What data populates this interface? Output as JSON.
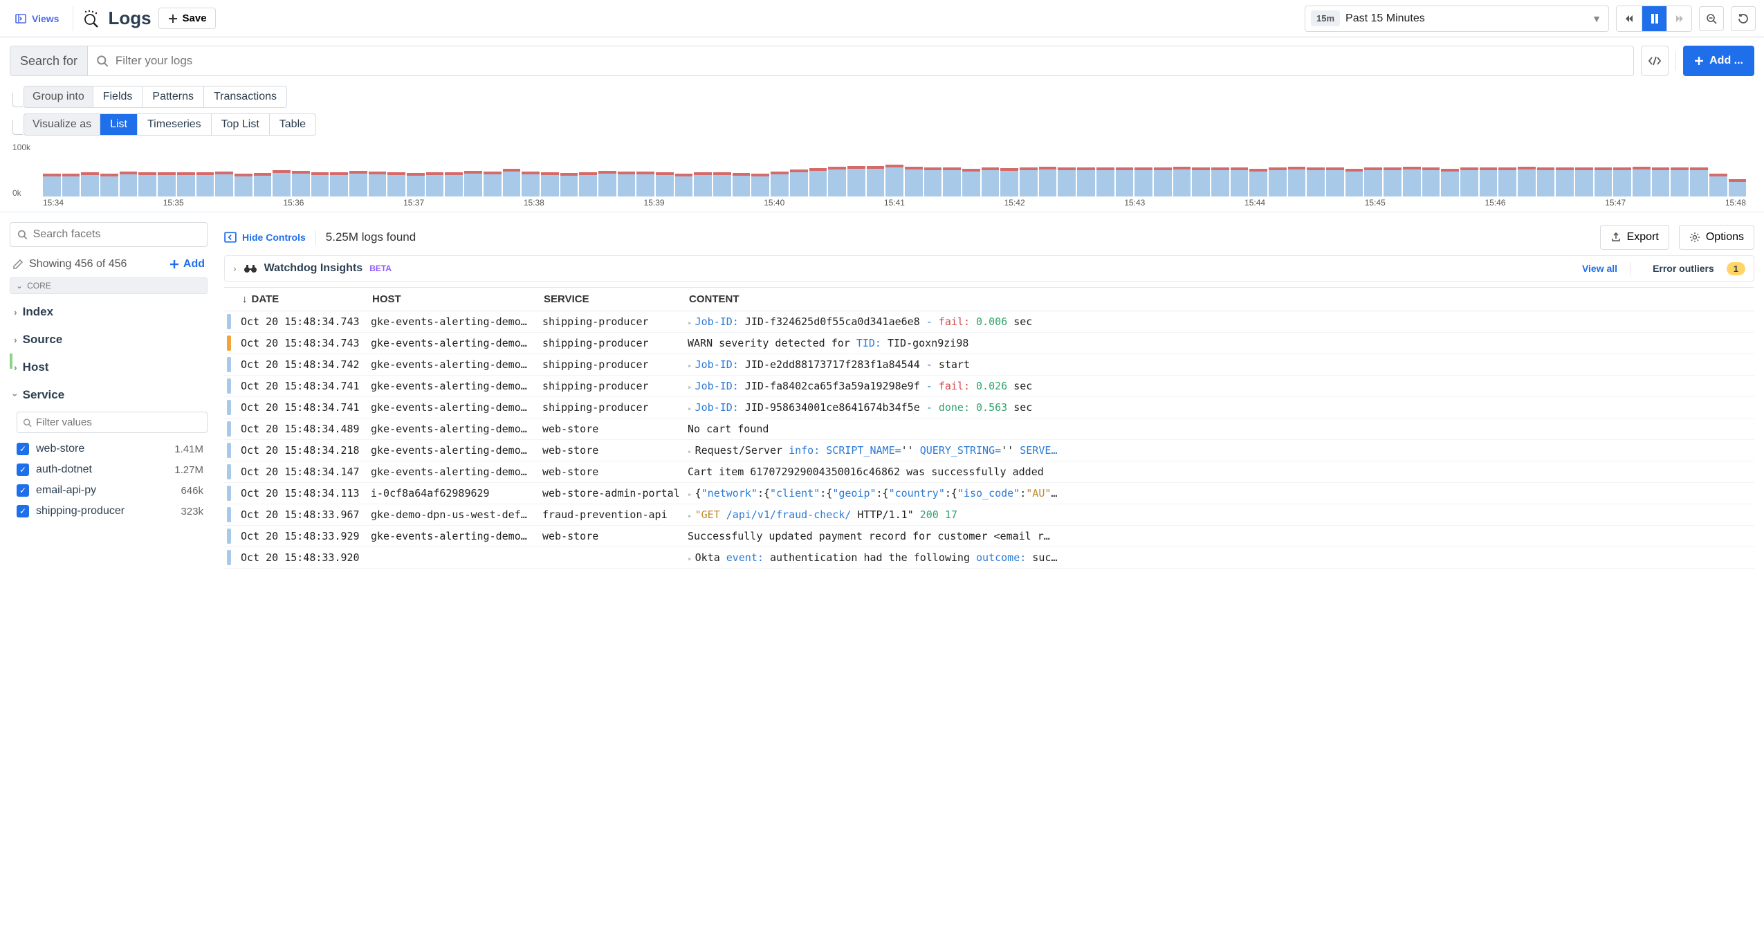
{
  "topbar": {
    "views": "Views",
    "title": "Logs",
    "save": "Save",
    "time_chip": "15m",
    "time_text": "Past 15 Minutes"
  },
  "search": {
    "label": "Search for",
    "placeholder": "Filter your logs",
    "add": "Add ..."
  },
  "group": {
    "label": "Group into",
    "fields": "Fields",
    "patterns": "Patterns",
    "transactions": "Transactions"
  },
  "visualize": {
    "label": "Visualize as",
    "list": "List",
    "timeseries": "Timeseries",
    "toplist": "Top List",
    "table": "Table"
  },
  "chart_data": {
    "type": "bar",
    "ylabel_top": "100k",
    "ylabel_bottom": "0k",
    "ylim": [
      0,
      100000
    ],
    "x_ticks": [
      "15:34",
      "15:35",
      "15:36",
      "15:37",
      "15:38",
      "15:39",
      "15:40",
      "15:41",
      "15:42",
      "15:43",
      "15:44",
      "15:45",
      "15:46",
      "15:47",
      "15:48"
    ],
    "series": [
      {
        "name": "logs",
        "values_k": [
          42,
          41,
          44,
          42,
          46,
          45,
          44,
          45,
          45,
          46,
          42,
          43,
          48,
          47,
          44,
          45,
          47,
          46,
          44,
          43,
          44,
          45,
          47,
          46,
          52,
          46,
          44,
          43,
          45,
          47,
          46,
          46,
          45,
          42,
          44,
          44,
          43,
          42,
          46,
          50,
          53,
          56,
          57,
          57,
          60,
          56,
          54,
          54,
          52,
          54,
          53,
          54,
          56,
          54,
          55,
          55,
          54,
          55,
          54,
          56,
          54,
          55,
          54,
          52,
          55,
          56,
          54,
          55,
          52,
          54,
          55,
          56,
          54,
          52,
          54,
          55,
          54,
          56,
          54,
          55,
          54,
          55,
          54,
          56,
          54,
          55,
          54,
          42,
          30
        ]
      }
    ]
  },
  "sidebar": {
    "facets_placeholder": "Search facets",
    "showing": "Showing 456 of 456",
    "add_label": "Add",
    "core": "CORE",
    "groups": {
      "index": "Index",
      "source": "Source",
      "host": "Host",
      "service": "Service"
    },
    "filter_values_placeholder": "Filter values",
    "service_items": [
      {
        "label": "web-store",
        "count": "1.41M"
      },
      {
        "label": "auth-dotnet",
        "count": "1.27M"
      },
      {
        "label": "email-api-py",
        "count": "646k"
      },
      {
        "label": "shipping-producer",
        "count": "323k"
      }
    ]
  },
  "content": {
    "hide_controls": "Hide Controls",
    "logs_found": "5.25M logs found",
    "export": "Export",
    "options": "Options",
    "watchdog": "Watchdog Insights",
    "beta": "BETA",
    "view_all": "View all",
    "error_outliers": "Error outliers",
    "outlier_count": "1",
    "columns": {
      "date": "DATE",
      "host": "HOST",
      "service": "SERVICE",
      "content": "CONTENT"
    }
  },
  "logs": [
    {
      "status": "info",
      "date": "Oct 20 15:48:34.743",
      "host": "gke-events-alerting-demo…",
      "service": "shipping-producer",
      "content_html": "<span class='tk-blue'>Job-ID:</span> JID-f324625d0f55ca0d341ae6e8 <span class='tk-blue'>-</span> <span class='tk-red'>fail:</span> <span class='tk-green'>0.006</span> sec"
    },
    {
      "status": "warn",
      "date": "Oct 20 15:48:34.743",
      "host": "gke-events-alerting-demo…",
      "service": "shipping-producer",
      "content_html": "WARN severity detected for <span class='tk-blue'>TID:</span> TID-goxn9zi98"
    },
    {
      "status": "info",
      "date": "Oct 20 15:48:34.742",
      "host": "gke-events-alerting-demo…",
      "service": "shipping-producer",
      "content_html": "<span class='tk-blue'>Job-ID:</span> JID-e2dd88173717f283f1a84544 <span class='tk-blue'>-</span> start"
    },
    {
      "status": "info",
      "date": "Oct 20 15:48:34.741",
      "host": "gke-events-alerting-demo…",
      "service": "shipping-producer",
      "content_html": "<span class='tk-blue'>Job-ID:</span> JID-fa8402ca65f3a59a19298e9f <span class='tk-blue'>-</span> <span class='tk-red'>fail:</span> <span class='tk-green'>0.026</span> sec"
    },
    {
      "status": "info",
      "date": "Oct 20 15:48:34.741",
      "host": "gke-events-alerting-demo…",
      "service": "shipping-producer",
      "content_html": "<span class='tk-blue'>Job-ID:</span> JID-958634001ce8641674b34f5e <span class='tk-blue'>-</span> <span class='tk-green'>done:</span> <span class='tk-green'>0.563</span> sec"
    },
    {
      "status": "info",
      "date": "Oct 20 15:48:34.489",
      "host": "gke-events-alerting-demo…",
      "service": "web-store",
      "content_html": "No cart found"
    },
    {
      "status": "info",
      "date": "Oct 20 15:48:34.218",
      "host": "gke-events-alerting-demo…",
      "service": "web-store",
      "content_html": "Request/Server <span class='tk-blue'>info:</span> <span class='tk-blue'>SCRIPT_NAME=</span>'' <span class='tk-blue'>QUERY_STRING=</span>'' <span class='tk-blue'>SERVE…</span>"
    },
    {
      "status": "info",
      "date": "Oct 20 15:48:34.147",
      "host": "gke-events-alerting-demo…",
      "service": "web-store",
      "content_html": "Cart item 617072929004350016c46862 was successfully added"
    },
    {
      "status": "info",
      "date": "Oct 20 15:48:34.113",
      "host": "i-0cf8a64af62989629",
      "service": "web-store-admin-portal",
      "content_html": "{<span class='tk-blue'>\"network\"</span>:{<span class='tk-blue'>\"client\"</span>:{<span class='tk-blue'>\"geoip\"</span>:{<span class='tk-blue'>\"country\"</span>:{<span class='tk-blue'>\"iso_code\"</span>:<span class='tk-orange'>\"AU\"</span>…"
    },
    {
      "status": "info",
      "date": "Oct 20 15:48:33.967",
      "host": "gke-demo-dpn-us-west-def…",
      "service": "fraud-prevention-api",
      "content_html": "<span class='tk-orange'>\"GET</span> <span class='tk-blue'>/api/v1/fraud-check/</span> HTTP/1.1\" <span class='tk-green'>200</span> <span class='tk-green'>17</span>"
    },
    {
      "status": "info",
      "date": "Oct 20 15:48:33.929",
      "host": "gke-events-alerting-demo…",
      "service": "web-store",
      "content_html": "Successfully updated payment record for customer &lt;email r…"
    },
    {
      "status": "info",
      "date": "Oct 20 15:48:33.920",
      "host": "",
      "service": "",
      "content_html": "Okta <span class='tk-blue'>event:</span> authentication had the following <span class='tk-blue'>outcome:</span> suc…"
    }
  ]
}
